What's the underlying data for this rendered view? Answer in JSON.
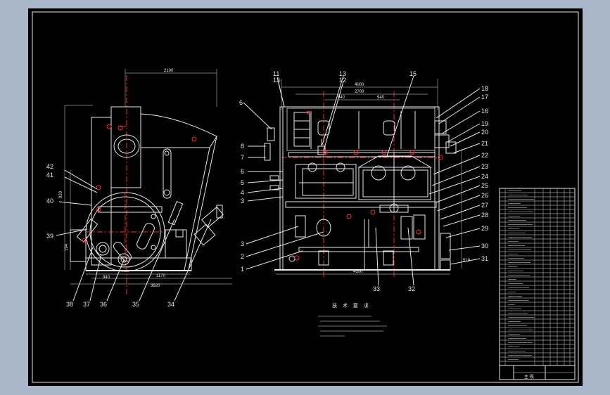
{
  "drawing": {
    "colors": {
      "background": "#000000",
      "line": "#e8e8e8",
      "centerline": "#ff2a2a",
      "frame_outside": "#aab6ca"
    },
    "callouts": [
      {
        "id": "c1",
        "text": "1"
      },
      {
        "id": "c2",
        "text": "2"
      },
      {
        "id": "c3a",
        "text": "3"
      },
      {
        "id": "c3b",
        "text": "3"
      },
      {
        "id": "c4",
        "text": "4"
      },
      {
        "id": "c5",
        "text": "5"
      },
      {
        "id": "c6a",
        "text": "6"
      },
      {
        "id": "c6b",
        "text": "6"
      },
      {
        "id": "c7",
        "text": "7"
      },
      {
        "id": "c8",
        "text": "8"
      },
      {
        "id": "c11",
        "text": "11"
      },
      {
        "id": "c12",
        "text": "12"
      },
      {
        "id": "c13a",
        "text": "13"
      },
      {
        "id": "c13b",
        "text": "13"
      },
      {
        "id": "c15",
        "text": "15"
      },
      {
        "id": "c16",
        "text": "16"
      },
      {
        "id": "c17",
        "text": "17"
      },
      {
        "id": "c18",
        "text": "18"
      },
      {
        "id": "c19",
        "text": "19"
      },
      {
        "id": "c20",
        "text": "20"
      },
      {
        "id": "c21",
        "text": "21"
      },
      {
        "id": "c22",
        "text": "22"
      },
      {
        "id": "c23",
        "text": "23"
      },
      {
        "id": "c24",
        "text": "24"
      },
      {
        "id": "c25",
        "text": "25"
      },
      {
        "id": "c26",
        "text": "26"
      },
      {
        "id": "c27",
        "text": "27"
      },
      {
        "id": "c28",
        "text": "28"
      },
      {
        "id": "c29",
        "text": "29"
      },
      {
        "id": "c30",
        "text": "30"
      },
      {
        "id": "c31",
        "text": "31"
      },
      {
        "id": "c32",
        "text": "32"
      },
      {
        "id": "c33",
        "text": "33"
      },
      {
        "id": "c34",
        "text": "34"
      },
      {
        "id": "c35",
        "text": "35"
      },
      {
        "id": "c36",
        "text": "36"
      },
      {
        "id": "c37",
        "text": "37"
      },
      {
        "id": "c38",
        "text": "38"
      },
      {
        "id": "c39",
        "text": "39"
      },
      {
        "id": "c40",
        "text": "40"
      },
      {
        "id": "c41",
        "text": "41"
      },
      {
        "id": "c42",
        "text": "42"
      }
    ],
    "dimensions": {
      "left_top": "2100",
      "left_bottom_a": "1170",
      "left_bottom_b": "3620",
      "left_bottom_c": "940",
      "left_height": "920",
      "left_side": "194",
      "right_top_a": "4000",
      "right_top_b": "2700",
      "right_top_c1": "940",
      "right_top_c2": "940",
      "right_bottom": "4500",
      "right_side": "519"
    },
    "notes": {
      "title": "技 术 要 求"
    },
    "title_block": {
      "main": "主 视"
    }
  }
}
